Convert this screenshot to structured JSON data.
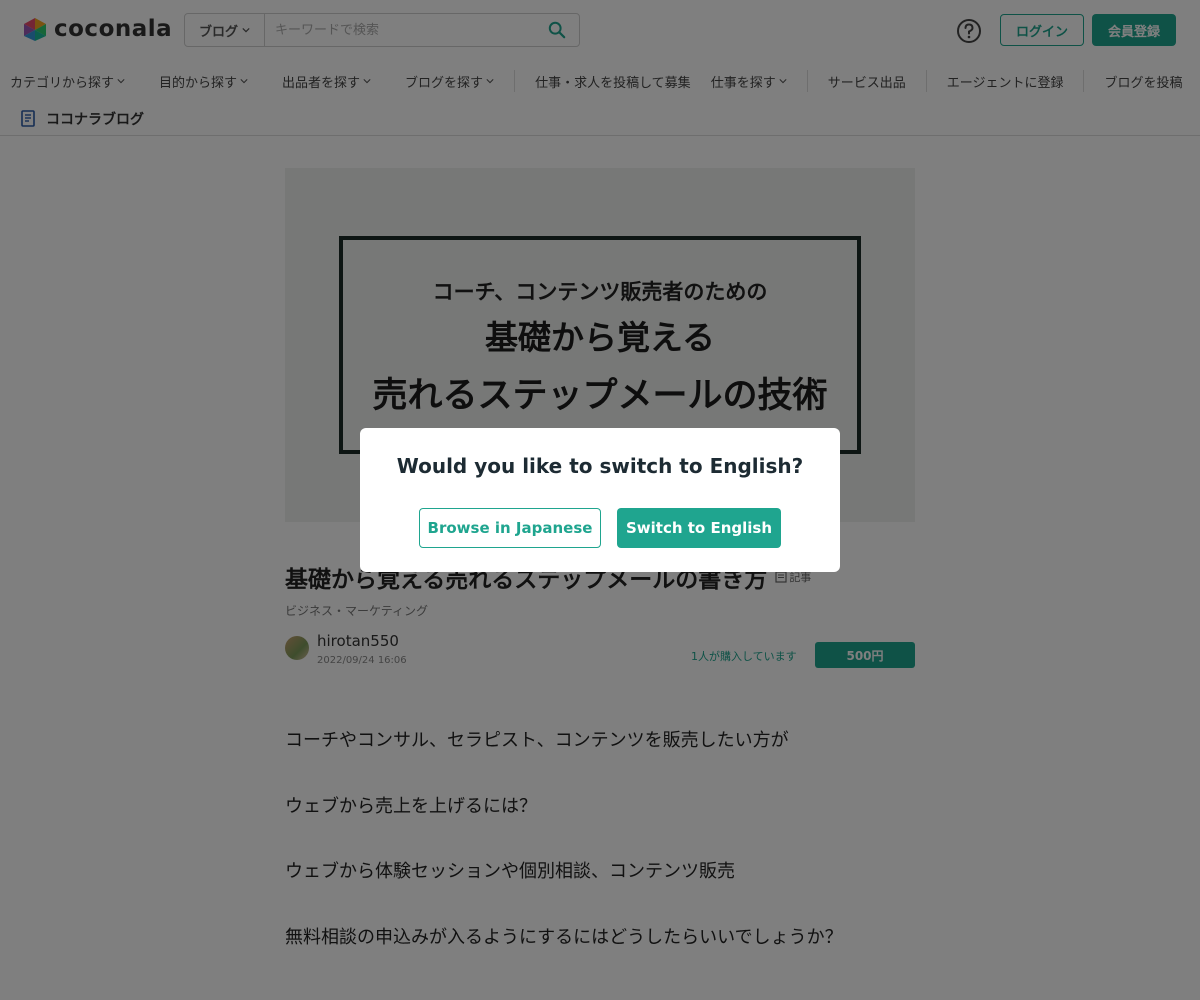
{
  "header": {
    "logo_text": "coconala",
    "search_category": "ブログ",
    "search_placeholder": "キーワードで検索",
    "login_label": "ログイン",
    "signup_label": "会員登録"
  },
  "nav": {
    "items": [
      "カテゴリから探す",
      "目的から探す",
      "出品者を探す",
      "ブログを探す",
      "仕事・求人を投稿して募集",
      "仕事を探す",
      "サービス出品",
      "エージェントに登録",
      "ブログを投稿"
    ]
  },
  "subheader": {
    "title": "ココナラブログ"
  },
  "article": {
    "hero_lines": [
      "コーチ、コンテンツ販売者のための",
      "基礎から覚える",
      "売れるステップメールの技術"
    ],
    "title": "基礎から覚える売れるステップメールの書き方",
    "type_badge": "記事",
    "category": "ビジネス・マーケティング",
    "author_name": "hirotan550",
    "date": "2022/09/24 16:06",
    "purchase_count": "1人が購入しています",
    "price": "500円",
    "paragraphs": [
      "コーチやコンサル、セラピスト、コンテンツを販売したい方が",
      "ウェブから売上を上げるには？",
      "ウェブから体験セッションや個別相談、コンテンツ販売",
      "無料相談の申込みが入るようにするにはどうしたらいいでしょうか？"
    ]
  },
  "modal": {
    "question": "Would you like to switch to English?",
    "japanese_label": "Browse in Japanese",
    "english_label": "Switch to English"
  },
  "colors": {
    "accent": "#1fa58f",
    "overlay": "rgba(0,0,0,0.5)"
  }
}
